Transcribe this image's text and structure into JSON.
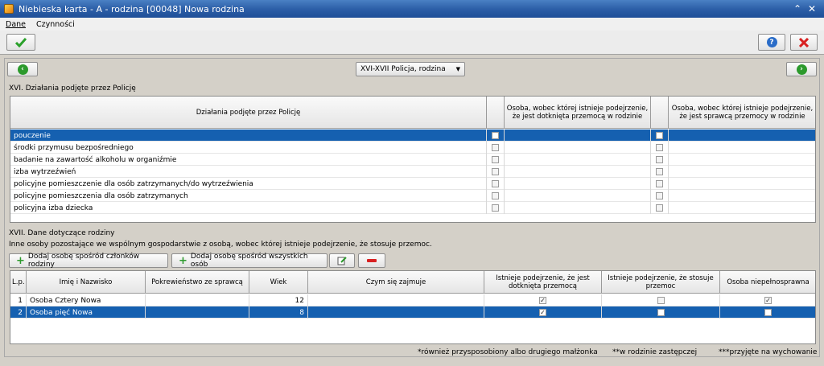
{
  "window": {
    "title": "Niebieska karta - A - rodzina [00048] Nowa rodzina",
    "collapse_glyph": "⌃",
    "close_glyph": "✕"
  },
  "menu": [
    "Dane",
    "Czynności"
  ],
  "toolbar": {
    "ok_icon": "check-icon",
    "help_icon": "help-icon",
    "cancel_icon": "cross-icon"
  },
  "nav": {
    "selected": "XVI-XVII Policja, rodzina",
    "dropdown_arrow": "▼"
  },
  "section16": {
    "title": "XVI. Działania podjęte przez Policję",
    "headers": [
      "Działania podjęte przez Policję",
      "Osoba, wobec której istnieje podejrzenie, że jest dotknięta przemocą w rodzinie",
      "Osoba, wobec której istnieje podejrzenie, że jest sprawcą przemocy w rodzinie"
    ],
    "rows": [
      {
        "label": "pouczenie",
        "c1": false,
        "c2": false,
        "selected": true
      },
      {
        "label": "środki przymusu bezpośredniego",
        "c1": false,
        "c2": false
      },
      {
        "label": "badanie na zawartość alkoholu w organiźmie",
        "c1": false,
        "c2": false
      },
      {
        "label": "izba wytrzeźwień",
        "c1": false,
        "c2": false
      },
      {
        "label": "policyjne pomieszczenie dla osób zatrzymanych/do wytrzeźwienia",
        "c1": false,
        "c2": false
      },
      {
        "label": "policyjne pomieszczenia dla osób zatrzymanych",
        "c1": false,
        "c2": false
      },
      {
        "label": "policyjna izba dziecka",
        "c1": false,
        "c2": false
      }
    ]
  },
  "section17": {
    "title": "XVII. Dane dotyczące rodziny",
    "subtitle": "Inne osoby pozostające we wspólnym gospodarstwie z osobą, wobec której istnieje podejrzenie, że stosuje przemoc.",
    "add_family_label": "Dodaj osobę spośród członków rodziny",
    "add_all_label": "Dodaj osobę spośród wszystkich osób",
    "headers": [
      "L.p.",
      "Imię i Nazwisko",
      "Pokrewieństwo ze sprawcą",
      "Wiek",
      "Czym się zajmuje",
      "Istnieje podejrzenie, że jest dotknięta przemocą",
      "Istnieje podejrzenie, że stosuje przemoc",
      "Osoba niepełnosprawna"
    ],
    "rows": [
      {
        "lp": "1",
        "name": "Osoba Cztery Nowa",
        "relation": "",
        "age": "12",
        "occupation": "",
        "victim": true,
        "perpetrator": false,
        "disabled": true
      },
      {
        "lp": "2",
        "name": "Osoba pięć Nowa",
        "relation": "",
        "age": "8",
        "occupation": "",
        "victim": true,
        "perpetrator": false,
        "disabled": false,
        "selected": true
      }
    ]
  },
  "footnotes": [
    "*również przysposobiony albo drugiego małżonka",
    "**w rodzinie zastępczej",
    "***przyjęte na wychowanie"
  ],
  "colors": {
    "selection": "#1560b0",
    "titlebar": "#2d5fa8"
  }
}
